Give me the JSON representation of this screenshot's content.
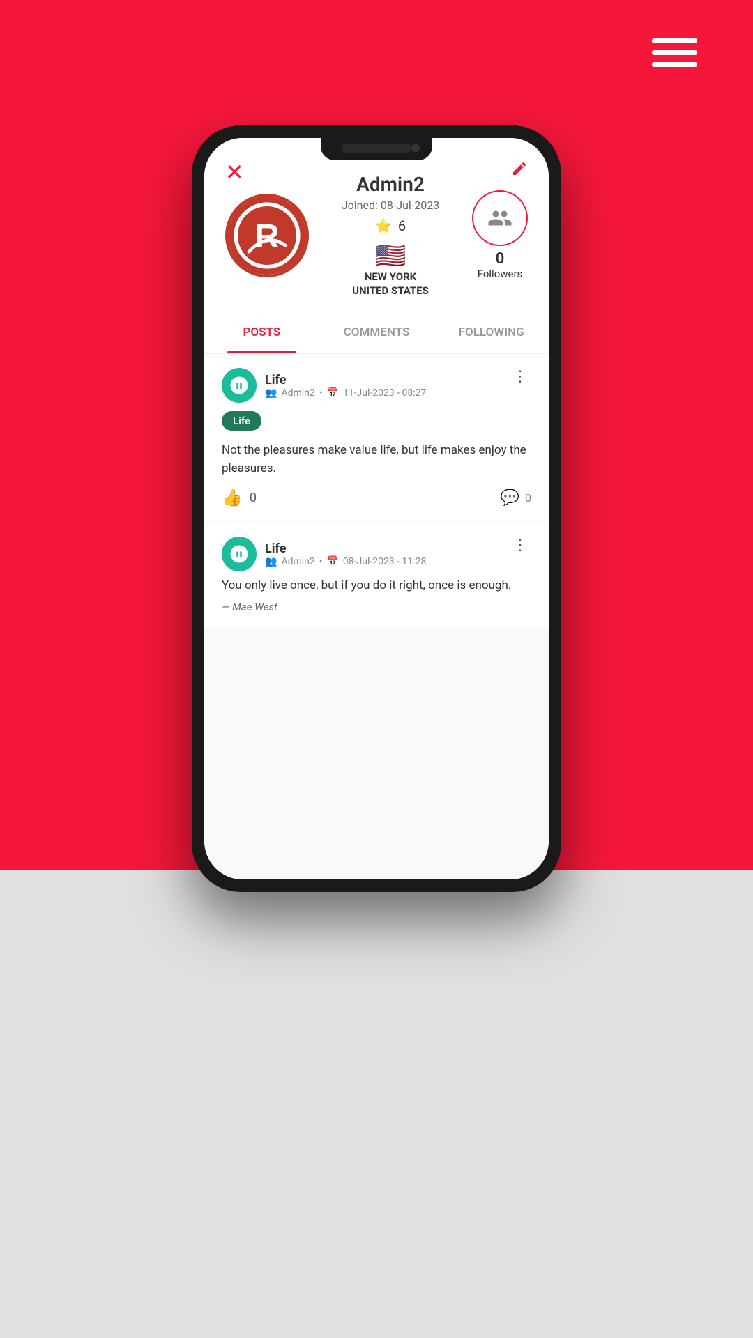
{
  "app": {
    "background_color_top": "#f5173a",
    "background_color_bottom": "#e0e0e0"
  },
  "hamburger": {
    "aria": "menu"
  },
  "phone": {
    "profile": {
      "close_label": "✕",
      "edit_label": "✏",
      "username": "Admin2",
      "joined": "Joined: 08-Jul-2023",
      "rating": "6",
      "flag": "🇺🇸",
      "location_line1": "NEW YORK",
      "location_line2": "UNITED STATES",
      "followers_count": "0",
      "followers_label": "Followers"
    },
    "tabs": [
      {
        "id": "posts",
        "label": "POSTS",
        "active": true
      },
      {
        "id": "comments",
        "label": "COMMENTS",
        "active": false
      },
      {
        "id": "following",
        "label": "FOLLOWING",
        "active": false
      }
    ],
    "posts": [
      {
        "id": "post-1",
        "category": "Life",
        "author": "Admin2",
        "date": "11-Jul-2023 - 08:27",
        "tag": "Life",
        "text": "Not the pleasures make value life, but life makes enjoy the pleasures.",
        "quote": "",
        "likes": "0",
        "comments": "0"
      },
      {
        "id": "post-2",
        "category": "Life",
        "author": "Admin2",
        "date": "08-Jul-2023 - 11:28",
        "tag": "",
        "text": "You only live once, but if you do it right, once is enough.",
        "quote": "— Mae West",
        "likes": "",
        "comments": ""
      }
    ]
  }
}
